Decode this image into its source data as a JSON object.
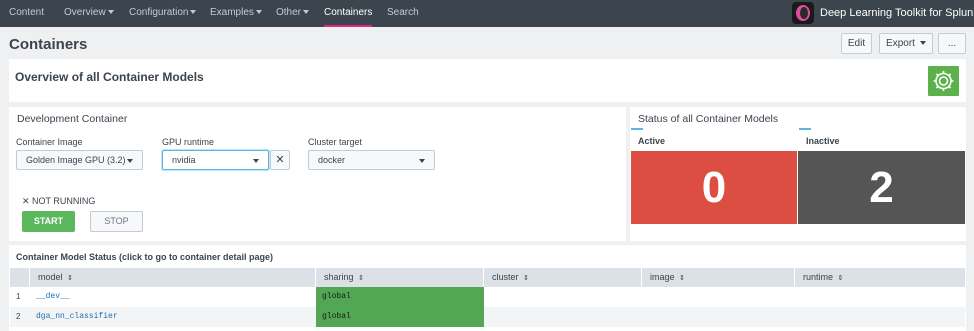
{
  "nav": {
    "items": [
      {
        "label": "Content",
        "dropdown": false,
        "active": false
      },
      {
        "label": "Overview",
        "dropdown": true,
        "active": false
      },
      {
        "label": "Configuration",
        "dropdown": true,
        "active": false
      },
      {
        "label": "Examples",
        "dropdown": true,
        "active": false
      },
      {
        "label": "Other",
        "dropdown": true,
        "active": false
      },
      {
        "label": "Containers",
        "dropdown": false,
        "active": true
      },
      {
        "label": "Search",
        "dropdown": false,
        "active": false
      }
    ],
    "app_title": "Deep Learning Toolkit for Splunk"
  },
  "page": {
    "title": "Containers",
    "edit_label": "Edit",
    "export_label": "Export",
    "more_label": "..."
  },
  "overview": {
    "title": "Overview of all Container Models",
    "gear_icon": "gear-icon"
  },
  "dev": {
    "title": "Development Container",
    "container_image_label": "Container Image",
    "container_image_value": "Golden Image GPU (3.2)",
    "gpu_runtime_label": "GPU runtime",
    "gpu_runtime_value": "nvidia",
    "clear_label": "✕",
    "cluster_target_label": "Cluster target",
    "cluster_target_value": "docker",
    "status": "✕ NOT RUNNING",
    "start_label": "START",
    "stop_label": "STOP"
  },
  "status_panel": {
    "title": "Status of all Container Models",
    "active_label": "Active",
    "active_value": "0",
    "inactive_label": "Inactive",
    "inactive_value": "2",
    "colors": {
      "active": "#dc4e41",
      "inactive": "#555555"
    }
  },
  "table": {
    "title": "Container Model Status (click to go to container detail page)",
    "sort_icon": "⇕",
    "columns": [
      "model",
      "sharing",
      "cluster",
      "image",
      "runtime"
    ],
    "rows": [
      {
        "num": "1",
        "model": "__dev__",
        "sharing": "global"
      },
      {
        "num": "2",
        "model": "dga_nn_classifier",
        "sharing": "global"
      }
    ],
    "colors": {
      "global": "#53a653"
    }
  }
}
